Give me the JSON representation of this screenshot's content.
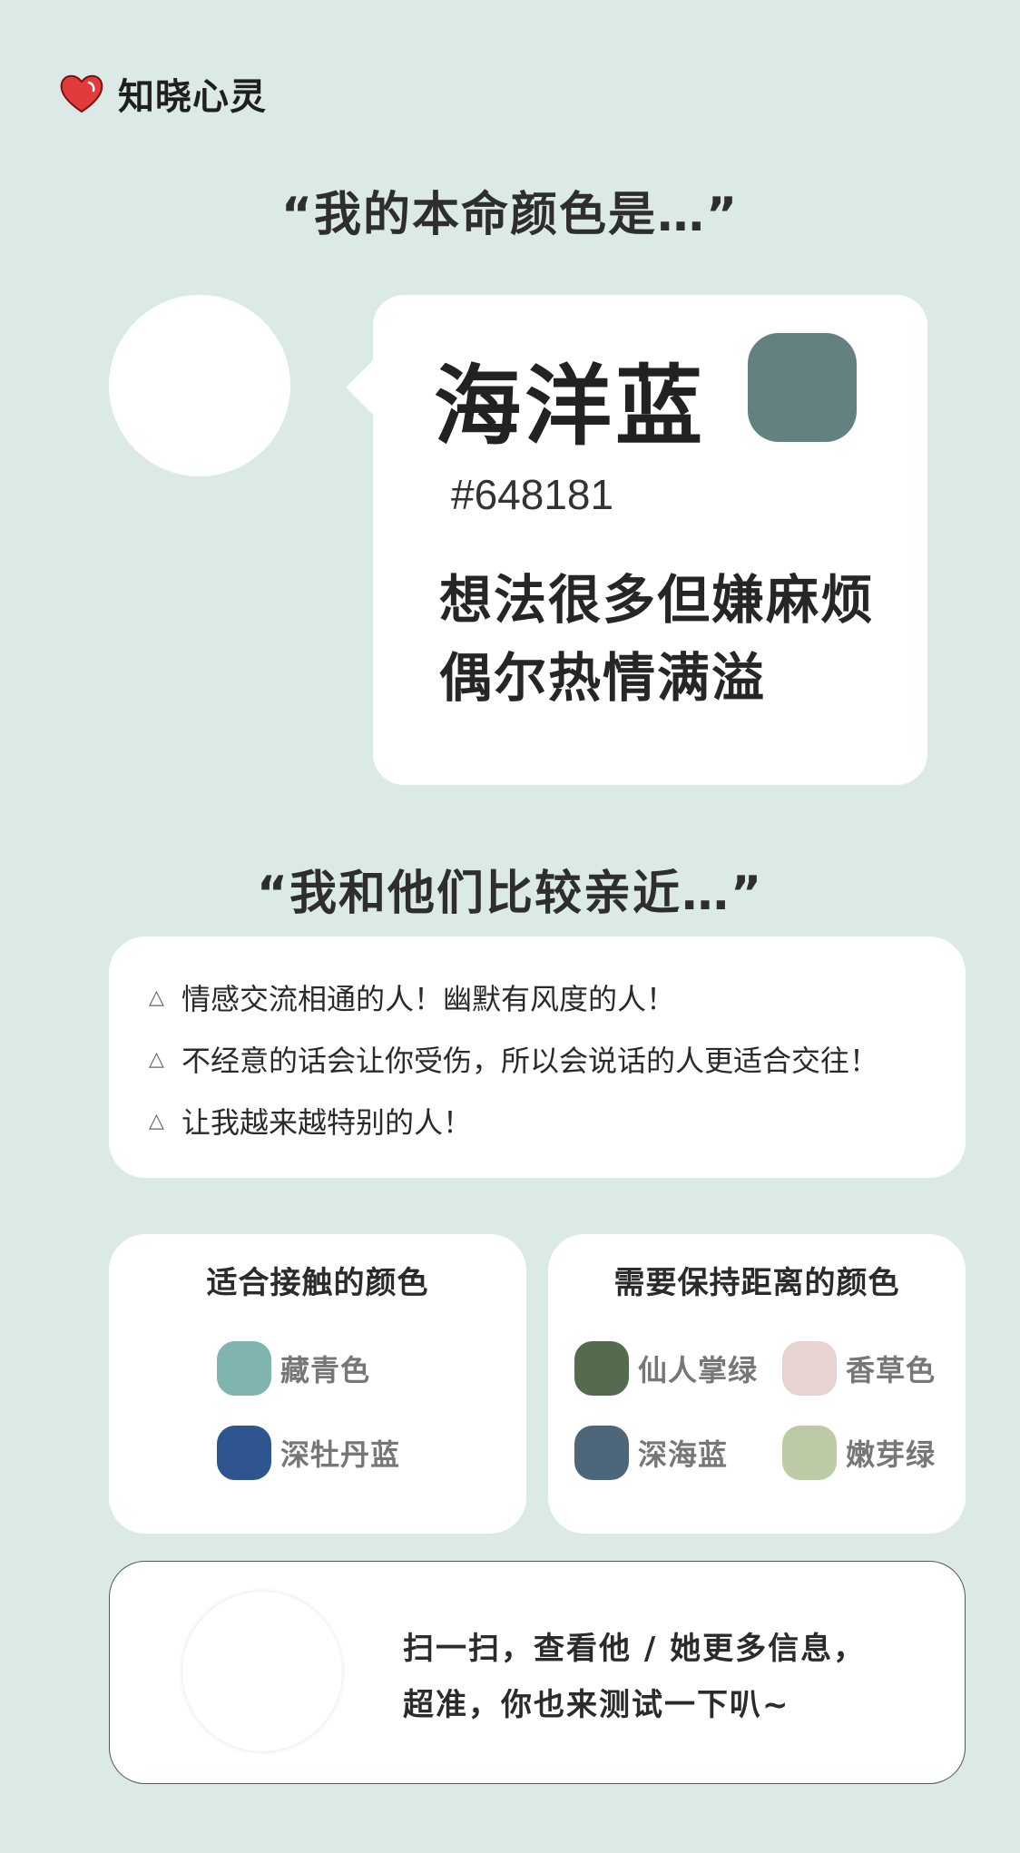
{
  "brand": {
    "name": "知晓心灵",
    "icon": "heart-icon",
    "icon_color": "#e23b3b"
  },
  "headings": {
    "own_color": "“我的本命颜色是…”",
    "close_to": "“我和他们比较亲近…”"
  },
  "main_color": {
    "name": "海洋蓝",
    "hex": "#648181",
    "swatch_color": "#648181",
    "desc_lines": [
      "想法很多但嫌麻烦",
      "偶尔热情满溢"
    ]
  },
  "traits": [
    {
      "icon": "triangle-icon",
      "text": "情感交流相通的人！幽默有风度的人！"
    },
    {
      "icon": "triangle-icon",
      "text": "不经意的话会让你受伤，所以会说话的人更适合交往！"
    },
    {
      "icon": "triangle-icon",
      "text": "让我越来越特别的人！"
    }
  ],
  "suitable": {
    "title": "适合接触的颜色",
    "colors": [
      {
        "name": "藏青色",
        "color": "#7fb5ae"
      },
      {
        "name": "深牡丹蓝",
        "color": "#2f5591"
      }
    ]
  },
  "distance": {
    "title": "需要保持距离的颜色",
    "colors": [
      {
        "name": "仙人掌绿",
        "color": "#556b50"
      },
      {
        "name": "香草色",
        "color": "#e8d3d3"
      },
      {
        "name": "深海蓝",
        "color": "#4d6679"
      },
      {
        "name": "嫩芽绿",
        "color": "#bccba5"
      }
    ]
  },
  "footer": {
    "lines": [
      "扫一扫，查看他 / 她更多信息，",
      "超准，你也来测试一下叭~"
    ]
  }
}
